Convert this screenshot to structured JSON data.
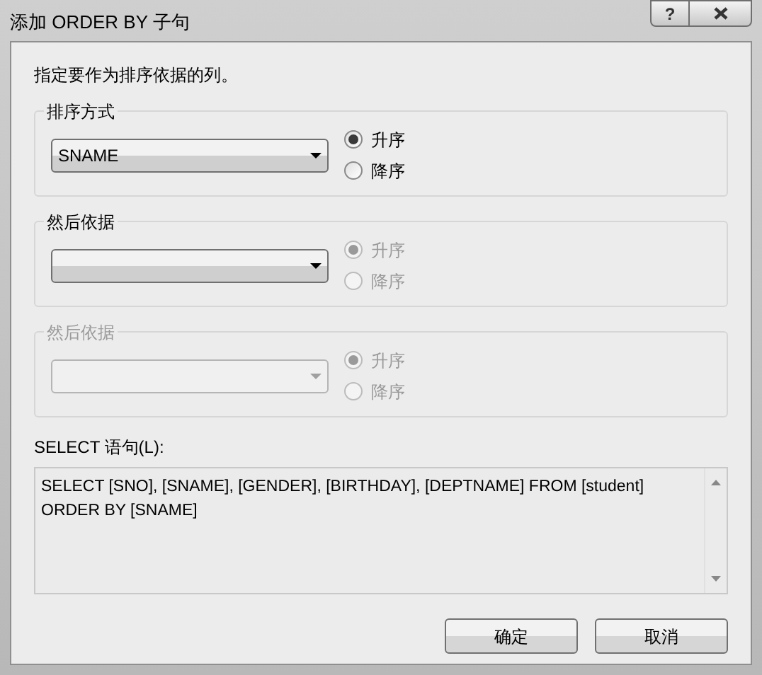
{
  "window": {
    "title": "添加 ORDER BY 子句",
    "help_button": "?"
  },
  "instruction": "指定要作为排序依据的列。",
  "groups": [
    {
      "legend": "排序方式",
      "disabled": false,
      "combo": {
        "value": "SNAME",
        "disabled": false
      },
      "options": [
        {
          "label": "升序",
          "selected": true,
          "disabled": false
        },
        {
          "label": "降序",
          "selected": false,
          "disabled": false
        }
      ]
    },
    {
      "legend": "然后依据",
      "disabled": false,
      "combo": {
        "disabled": false
      },
      "options": [
        {
          "label": "升序",
          "selected": true,
          "disabled": true
        },
        {
          "label": "降序",
          "selected": false,
          "disabled": true
        }
      ]
    },
    {
      "legend": "然后依据",
      "disabled": true,
      "combo": {
        "disabled": true
      },
      "options": [
        {
          "label": "升序",
          "selected": true,
          "disabled": true
        },
        {
          "label": "降序",
          "selected": false,
          "disabled": true
        }
      ]
    }
  ],
  "sql_label": "SELECT 语句(L):",
  "sql_text": "SELECT [SNO], [SNAME], [GENDER], [BIRTHDAY], [DEPTNAME] FROM [student]\nORDER BY [SNAME]",
  "buttons": [
    {
      "label": "确定"
    },
    {
      "label": "取消"
    }
  ]
}
